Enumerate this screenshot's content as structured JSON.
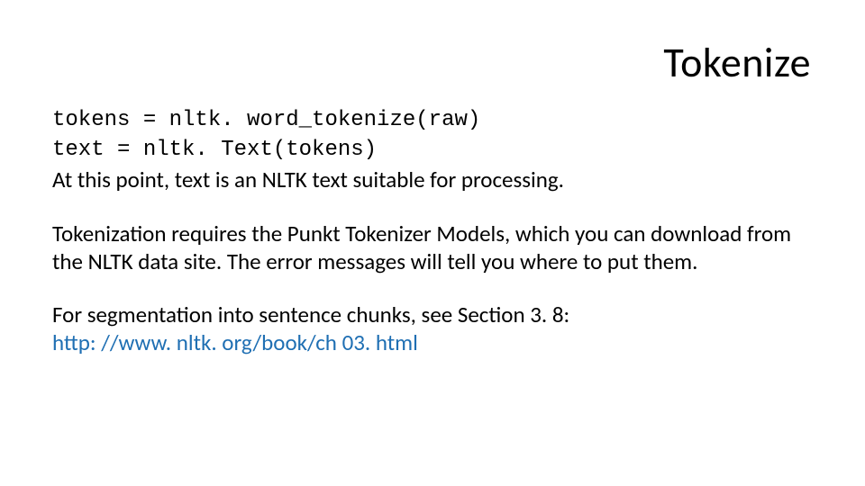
{
  "title": "Tokenize",
  "code_line1": "tokens = nltk. word_tokenize(raw)",
  "code_line2": "text = nltk. Text(tokens)",
  "para1": "At this point, text is an NLTK text suitable for processing.",
  "para2": "Tokenization requires the Punkt Tokenizer Models, which you can download from the NLTK data site. The error messages will tell you where to put them.",
  "para3": "For segmentation into sentence chunks, see Section 3. 8:",
  "link": "http: //www. nltk. org/book/ch 03. html"
}
